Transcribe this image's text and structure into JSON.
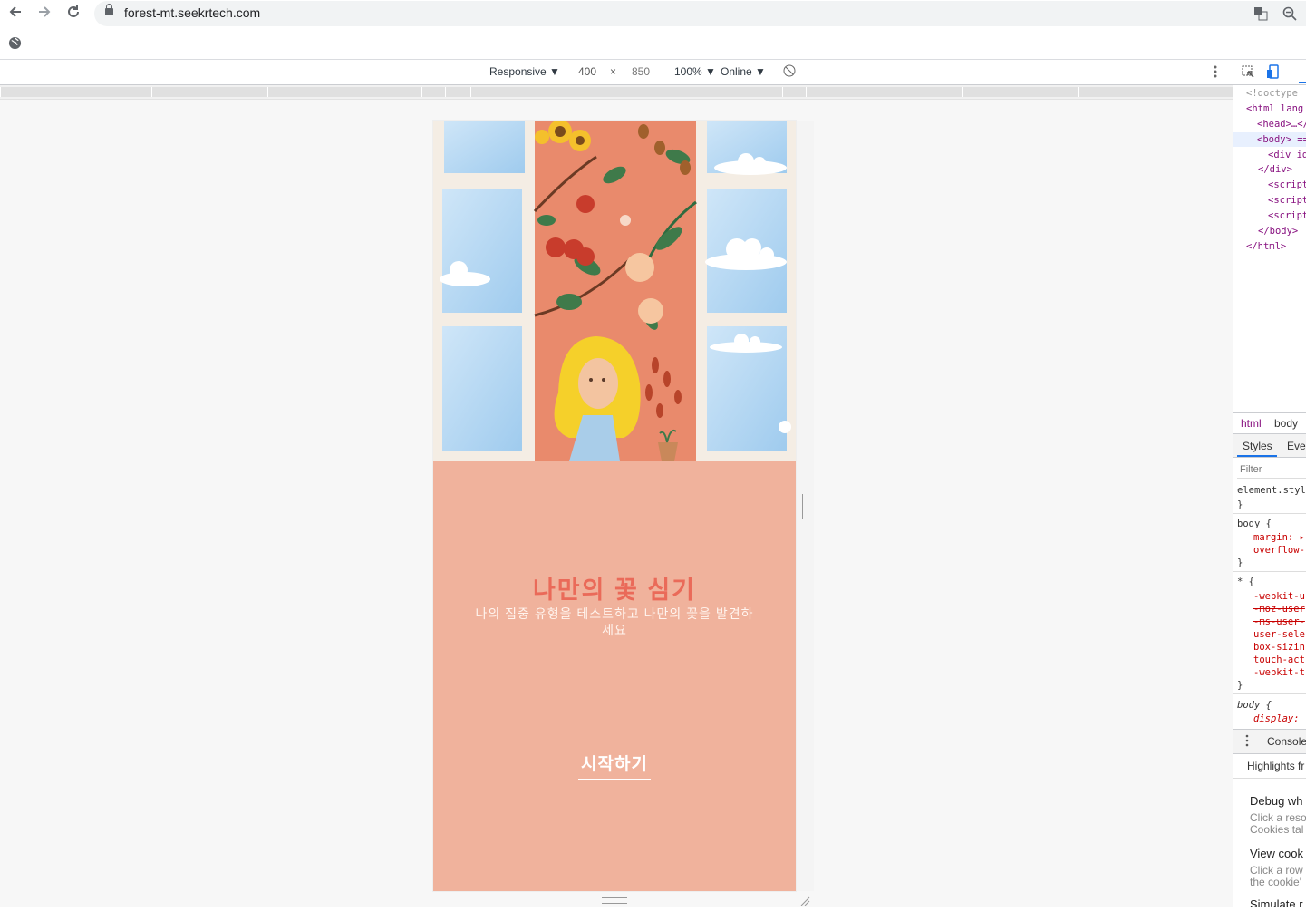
{
  "browser": {
    "url": "forest-mt.seekrtech.com",
    "back_icon": "arrow-left-icon",
    "forward_icon": "arrow-right-icon",
    "reload_icon": "reload-icon"
  },
  "device_toolbar": {
    "device": "Responsive ▼",
    "width": "400",
    "times": "×",
    "height": "850",
    "zoom": "100% ▼",
    "network": "Online ▼"
  },
  "page": {
    "title": "나만의 꽃 심기",
    "subtitle": "나의 집중 유형을 테스트하고 나만의 꽃을 발견하세요",
    "start_button": "시작하기",
    "bg_color": "#f0b29c",
    "accent_color": "#ea6a59"
  },
  "devtools": {
    "elements": [
      "<!doctype",
      "<html lang",
      "<head>…</",
      "<body> ==",
      "<div id",
      "</div>",
      "<script",
      "<script",
      "<script",
      "</body>",
      "</html>"
    ],
    "breadcrumb": [
      "html",
      "body"
    ],
    "tabs": [
      "Styles",
      "Even"
    ],
    "filter_placeholder": "Filter",
    "styles": {
      "element_style": "element.styl",
      "close": "}",
      "body_selector": "body {",
      "body_props": [
        "margin: ▸",
        "overflow-"
      ],
      "star_selector": "* {",
      "star_props_struck": [
        "-webkit-u",
        "-moz-user",
        "-ms-user-"
      ],
      "star_props": [
        "user-sele",
        "box-sizin",
        "touch-act",
        "-webkit-t"
      ],
      "body2_selector": "body {",
      "body2_props": [
        "display:"
      ]
    },
    "drawer_tab": "Console",
    "drawer_highlight": "Highlights fr",
    "drawer_items": [
      {
        "title": "Debug wh",
        "desc": "Click a reso Cookies tal"
      },
      {
        "title": "View cook",
        "desc": "Click a row the cookie'"
      },
      {
        "title": "Simulate r",
        "desc": ""
      }
    ]
  }
}
